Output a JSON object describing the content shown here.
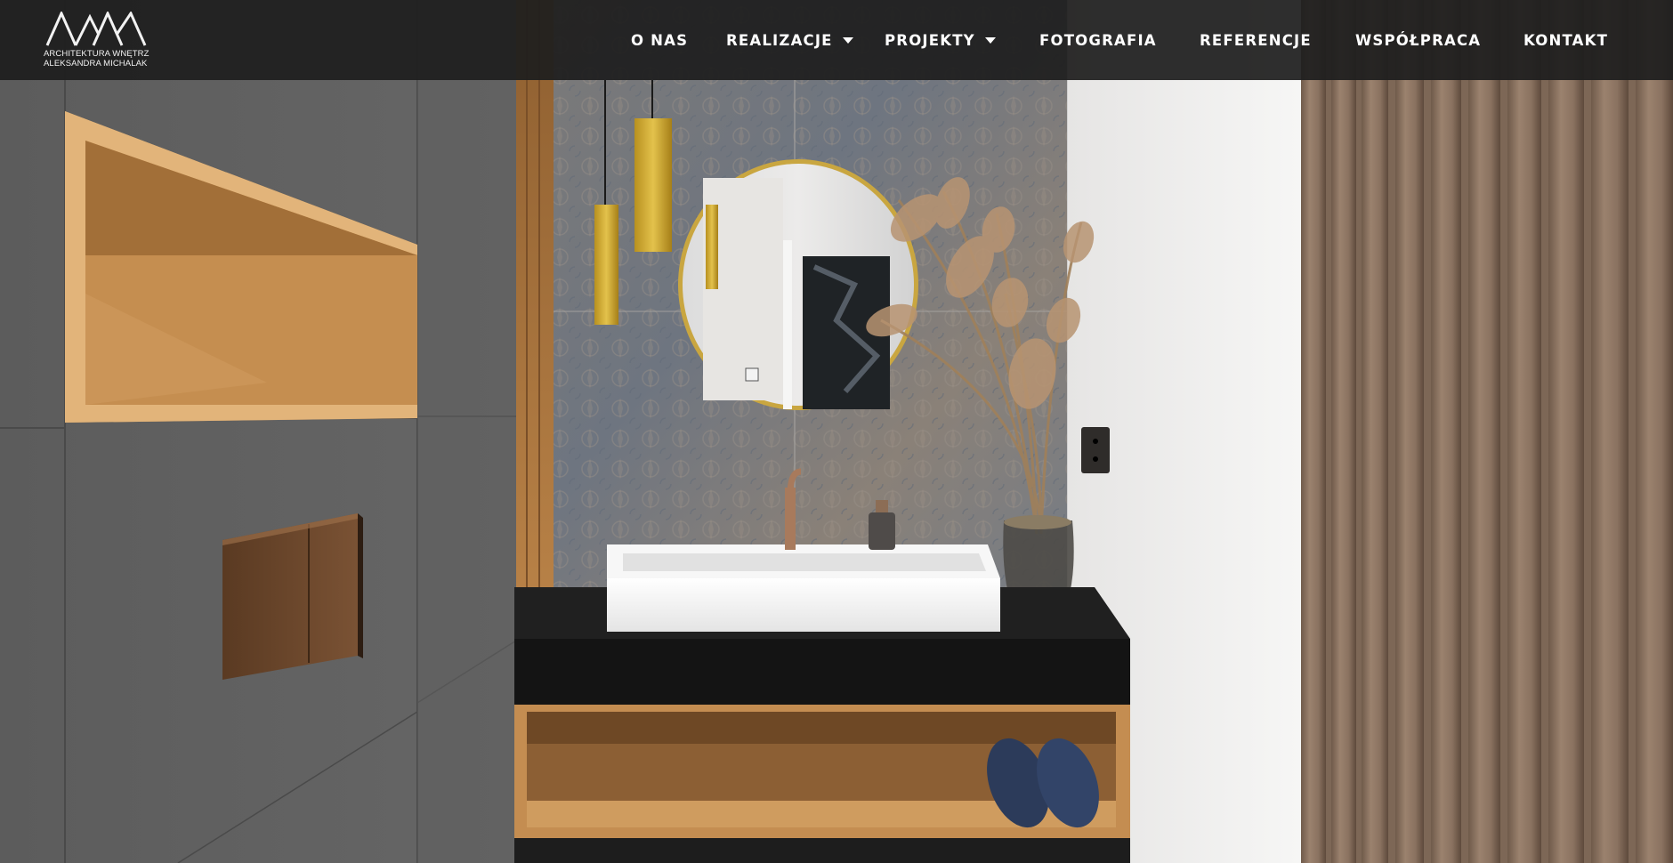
{
  "brand": {
    "logo_line1": "ARCHITEKTURA WNĘTRZ",
    "logo_line2": "ALEKSANDRA MICHALAK",
    "logo_icon": "aam-monogram-icon"
  },
  "nav": {
    "items": [
      {
        "label": "O NAS",
        "dropdown": false
      },
      {
        "label": "REALIZACJE",
        "dropdown": true
      },
      {
        "label": "PROJEKTY",
        "dropdown": true
      },
      {
        "label": "FOTOGRAFIA",
        "dropdown": false
      },
      {
        "label": "REFERENCJE",
        "dropdown": false
      },
      {
        "label": "WSPÓŁPRACA",
        "dropdown": false
      },
      {
        "label": "KONTAKT",
        "dropdown": false
      }
    ]
  },
  "hero": {
    "subject": "bathroom-interior-photo"
  },
  "colors": {
    "navbar_bg": "#1e1e1e",
    "nav_text": "#ffffff",
    "cabinet_grey": "#5b5b5b",
    "oak": "#c8955a",
    "countertop": "#1a1a1a",
    "radiator": "#8b7461",
    "wall": "#f0efee"
  }
}
